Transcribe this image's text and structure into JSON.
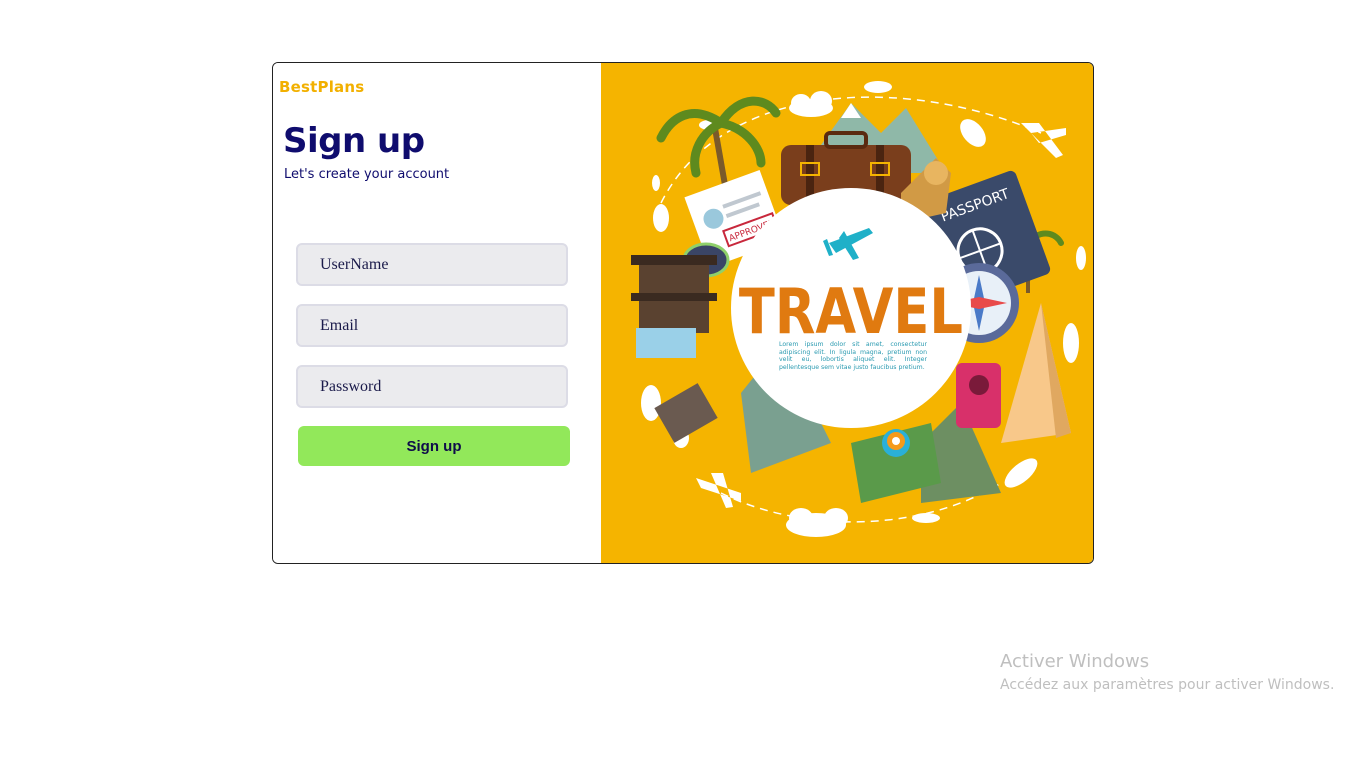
{
  "brand": {
    "name": "BestPlans",
    "color": "#f2b000"
  },
  "form": {
    "title": "Sign up",
    "subtitle": "Let's create your account",
    "username_placeholder": "UserName",
    "email_placeholder": "Email",
    "password_placeholder": "Password",
    "submit_label": "Sign up",
    "submit_color": "#92e85a"
  },
  "illustration": {
    "heading": "TRAVEL",
    "body": "Lorem ipsum dolor sit amet, consectetur adipiscing elit. In ligula magna, pretium non velit eu, lobortis aliquet elit. Integer pellentesque sem vitae justo faucibus pretium.",
    "passport_label": "PASSPORT",
    "stamp_label": "APPROVED",
    "background_color": "#f5b400",
    "accent_color": "#e07a10"
  },
  "watermark": {
    "title": "Activer Windows",
    "subtitle": "Accédez aux paramètres pour activer Windows."
  }
}
